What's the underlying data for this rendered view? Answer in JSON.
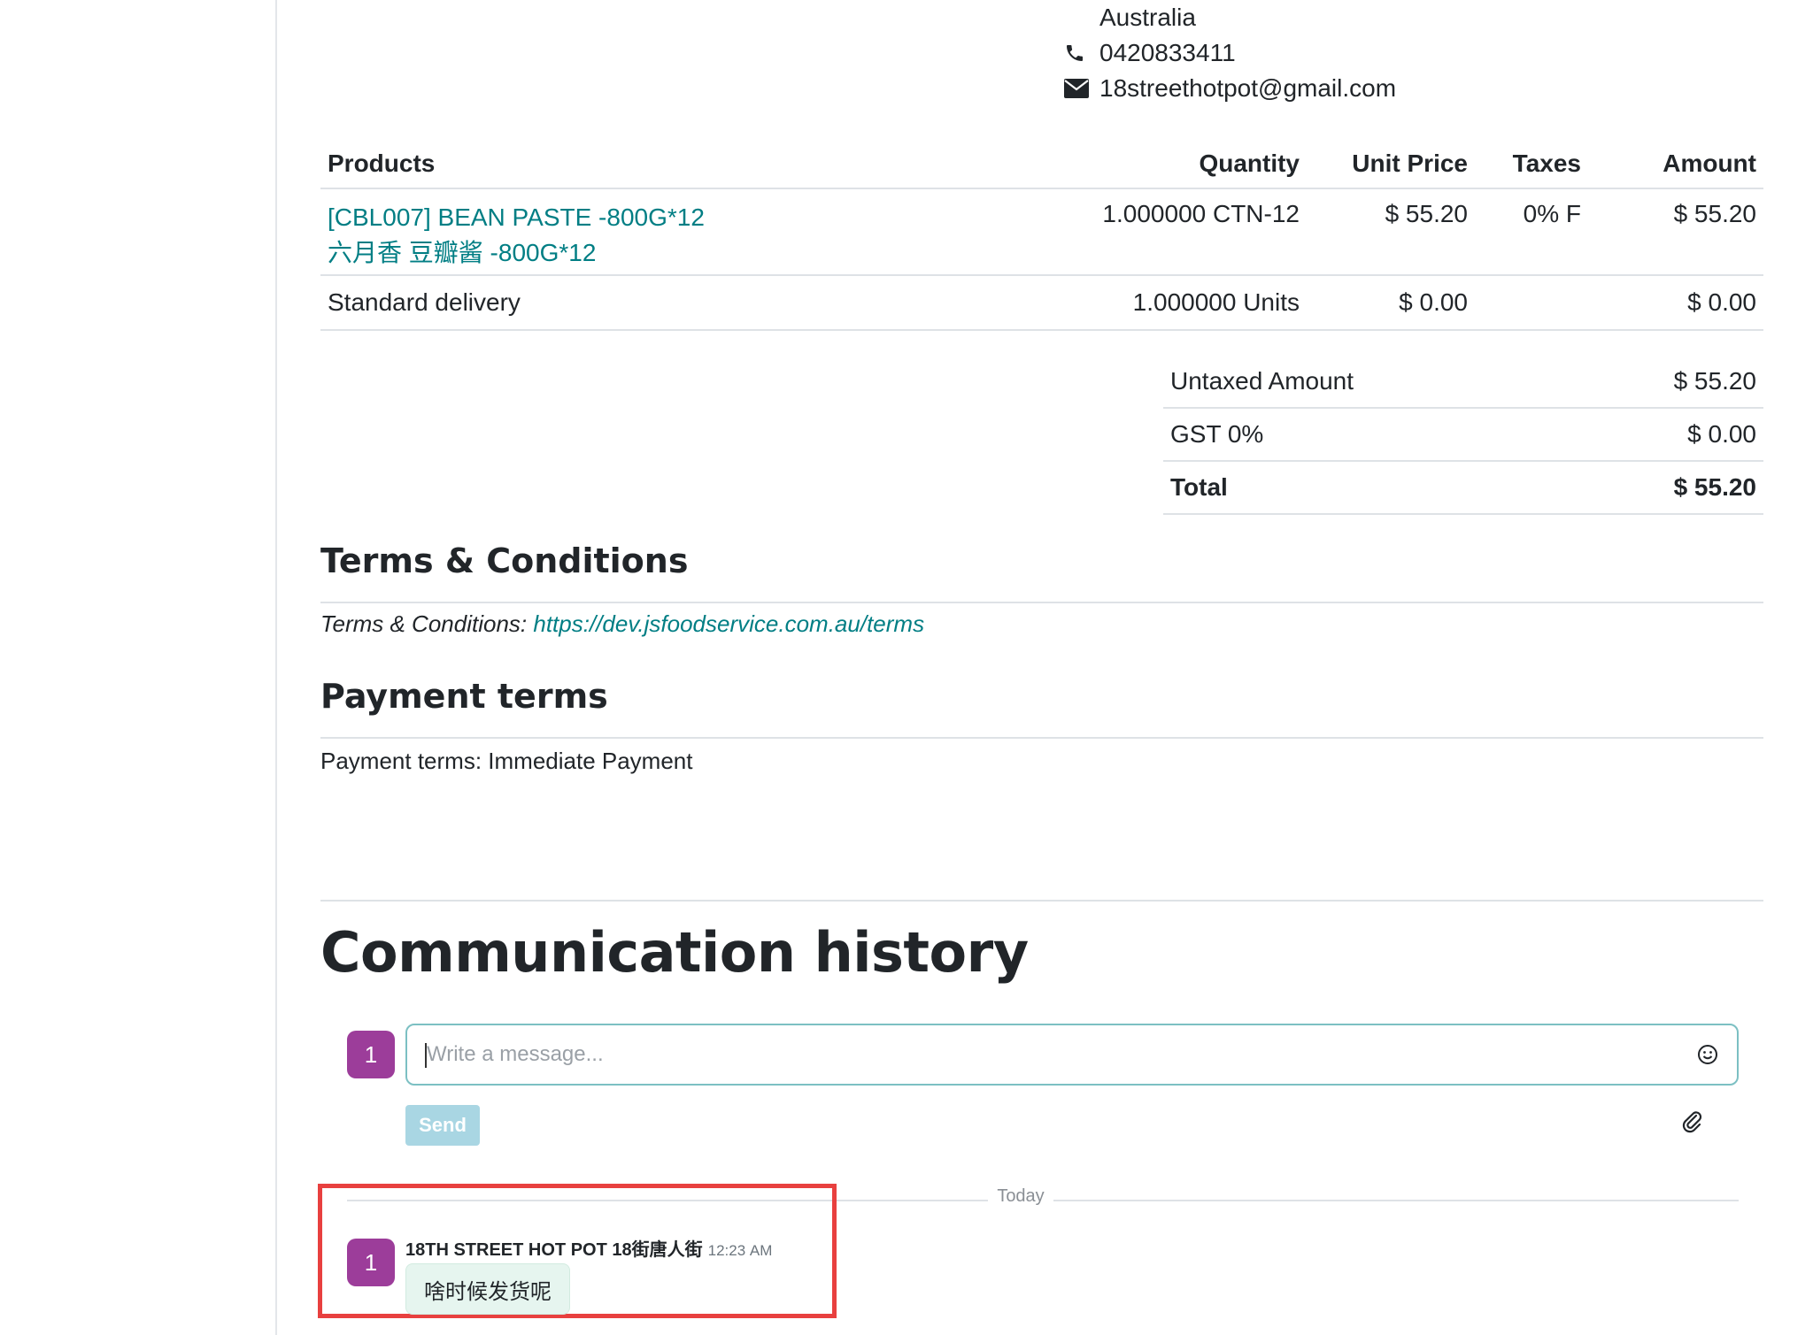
{
  "address": {
    "country": "Australia",
    "phone": "0420833411",
    "email": "18streethotpot@gmail.com"
  },
  "products_table": {
    "headers": [
      "Products",
      "Quantity",
      "Unit Price",
      "Taxes",
      "Amount"
    ],
    "rows": [
      {
        "product_line1": "[CBL007] BEAN PASTE -800G*12",
        "product_line2": "六月香 豆瓣酱 -800G*12",
        "quantity": "1.000000 CTN-12",
        "unit_price": "$ 55.20",
        "taxes": "0% F",
        "amount": "$ 55.20"
      },
      {
        "product": "Standard delivery",
        "quantity": "1.000000 Units",
        "unit_price": "$ 0.00",
        "taxes": "",
        "amount": "$ 0.00"
      }
    ]
  },
  "totals": [
    {
      "label": "Untaxed Amount",
      "value": "$ 55.20"
    },
    {
      "label": "GST 0%",
      "value": "$ 0.00"
    },
    {
      "label": "Total",
      "value": "$ 55.20"
    }
  ],
  "terms": {
    "heading": "Terms & Conditions",
    "label": "Terms & Conditions: ",
    "link": "https://dev.jsfoodservice.com.au/terms"
  },
  "payment": {
    "heading": "Payment terms",
    "text": "Payment terms: Immediate Payment"
  },
  "communication": {
    "heading": "Communication history",
    "avatar_initial": "1",
    "composer_placeholder": "Write a message...",
    "send_label": "Send",
    "divider_label": "Today",
    "message": {
      "avatar_initial": "1",
      "author": "18TH STREET HOT POT 18街唐人街",
      "time": "12:23 AM",
      "text": "啥时候发货呢"
    }
  },
  "colors": {
    "link": "#017e84",
    "avatar": "#9c3d9a",
    "send_button": "#a9d6e3",
    "highlight_border": "#e8403f",
    "message_bubble": "#e6f5ef"
  }
}
